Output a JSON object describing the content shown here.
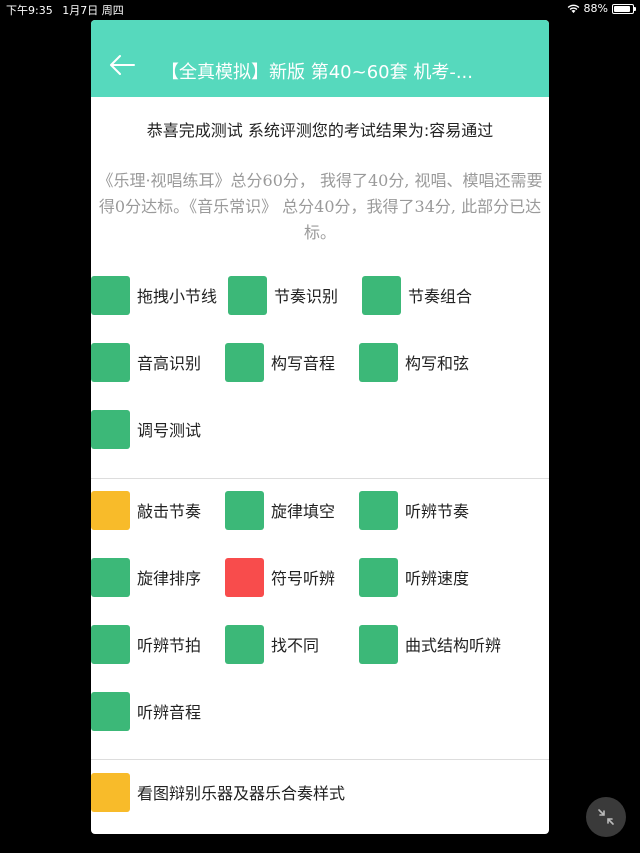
{
  "status": {
    "time": "下午9:35",
    "date": "1月7日 周四",
    "battery": "88%"
  },
  "header": {
    "title": "【全真模拟】新版 第40~60套 机考-..."
  },
  "result": {
    "text": "恭喜完成测试 系统评测您的考试结果为:容易通过"
  },
  "summary": {
    "text": "《乐理·视唱练耳》总分60分， 我得了40分, 视唱、模唱还需要得0分达标。《音乐常识》 总分40分，我得了34分, 此部分已达标。"
  },
  "colors": {
    "header": "#56d9bd",
    "green": "#3cb878",
    "yellow": "#f8bb2a",
    "red": "#f84c4c"
  },
  "section1": [
    {
      "label": "拖拽小节线",
      "status": "green"
    },
    {
      "label": "节奏识别",
      "status": "green"
    },
    {
      "label": "节奏组合",
      "status": "green"
    },
    {
      "label": "音高识别",
      "status": "green"
    },
    {
      "label": "构写音程",
      "status": "green"
    },
    {
      "label": "构写和弦",
      "status": "green"
    },
    {
      "label": "调号测试",
      "status": "green"
    }
  ],
  "section2": [
    {
      "label": "敲击节奏",
      "status": "yellow"
    },
    {
      "label": "旋律填空",
      "status": "green"
    },
    {
      "label": "听辨节奏",
      "status": "green"
    },
    {
      "label": "旋律排序",
      "status": "green"
    },
    {
      "label": "符号听辨",
      "status": "red"
    },
    {
      "label": "听辨速度",
      "status": "green"
    },
    {
      "label": "听辨节拍",
      "status": "green"
    },
    {
      "label": "找不同",
      "status": "green"
    },
    {
      "label": "曲式结构听辨",
      "status": "green"
    },
    {
      "label": "听辨音程",
      "status": "green"
    }
  ],
  "section3": [
    {
      "label": "看图辩别乐器及器乐合奏样式",
      "status": "yellow"
    }
  ],
  "icons": {
    "back": "arrow-left-icon",
    "wifi": "wifi-icon",
    "battery": "battery-icon",
    "collapse": "collapse-icon"
  }
}
